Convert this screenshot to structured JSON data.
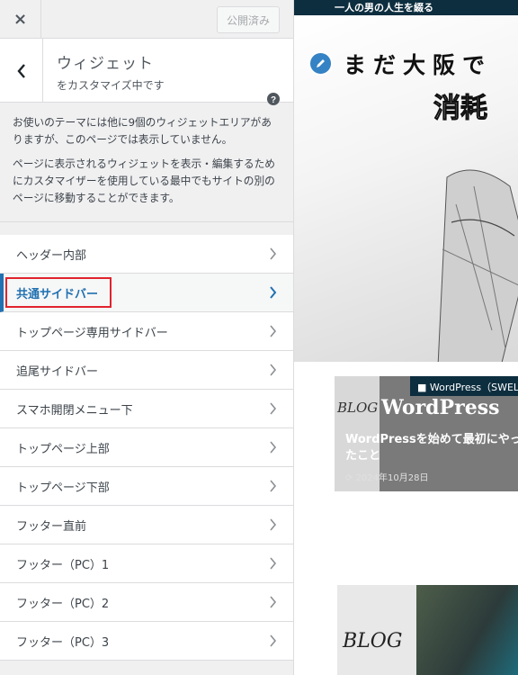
{
  "topbar": {
    "close_label": "×",
    "publish_label": "公開済み"
  },
  "section": {
    "title": "ウィジェット",
    "subtitle": "をカスタマイズ中です"
  },
  "description": [
    "お使いのテーマには他に9個のウィジェットエリアがありますが、このページでは表示していません。",
    "ページに表示されるウィジェットを表示・編集するためにカスタマイザーを使用している最中でもサイトの別のページに移動することができます。"
  ],
  "widget_areas": [
    {
      "label": "ヘッダー内部",
      "active": false
    },
    {
      "label": "共通サイドバー",
      "active": true
    },
    {
      "label": "トップページ専用サイドバー",
      "active": false
    },
    {
      "label": "追尾サイドバー",
      "active": false
    },
    {
      "label": "スマホ開閉メニュー下",
      "active": false
    },
    {
      "label": "トップページ上部",
      "active": false
    },
    {
      "label": "トップページ下部",
      "active": false
    },
    {
      "label": "フッター直前",
      "active": false
    },
    {
      "label": "フッター（PC）1",
      "active": false
    },
    {
      "label": "フッター（PC）2",
      "active": false
    },
    {
      "label": "フッター（PC）3",
      "active": false
    }
  ],
  "preview": {
    "site_bar": "一人の男の人生を綴る",
    "hero_title": "まだ大阪で",
    "hero_sub": "消耗",
    "card1": {
      "category": "WordPress（SWELL",
      "logo_text": "WordPress",
      "blog_text": "BLOG",
      "title": "WordPressを始めて最初にやったこと",
      "date": "2024年10月28日"
    },
    "card2": {
      "blog_text": "BLOG"
    }
  },
  "colors": {
    "accent": "#2271b1",
    "highlight_box": "#e0242d",
    "site_bar_bg": "#0d2e3f"
  }
}
